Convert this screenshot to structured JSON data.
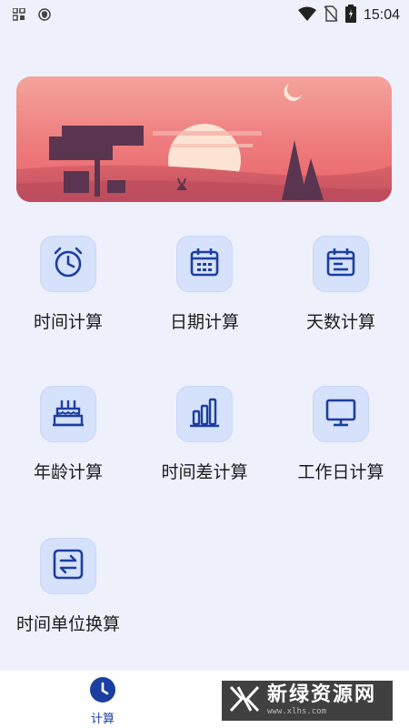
{
  "status_bar": {
    "time": "15:04",
    "left_icons": [
      "grid-icon",
      "shield-icon"
    ],
    "right_icons": [
      "wifi-icon",
      "no-sim-icon",
      "battery-icon"
    ]
  },
  "banner": {
    "colors": {
      "sky_top": "#f08a88",
      "sky_mid": "#ec6f72",
      "sun": "#fde0d0",
      "silhouette": "#5a3550"
    }
  },
  "grid": [
    {
      "label": "时间计算",
      "icon": "alarm-clock-icon"
    },
    {
      "label": "日期计算",
      "icon": "calendar-icon"
    },
    {
      "label": "天数计算",
      "icon": "calendar-days-icon"
    },
    {
      "label": "年龄计算",
      "icon": "birthday-cake-icon"
    },
    {
      "label": "时间差计算",
      "icon": "bar-chart-icon"
    },
    {
      "label": "工作日计算",
      "icon": "monitor-icon"
    },
    {
      "label": "时间单位换算",
      "icon": "swap-arrows-icon"
    }
  ],
  "bottom_nav": {
    "items": [
      {
        "label": "计算",
        "icon": "clock-icon",
        "active": true
      }
    ]
  },
  "watermark": {
    "title": "新绿资源网",
    "url": "www.xlhs.com"
  },
  "colors": {
    "accent": "#1b3fa0",
    "icon_bg": "#d6e1fb",
    "page_bg": "#eef1fc"
  }
}
